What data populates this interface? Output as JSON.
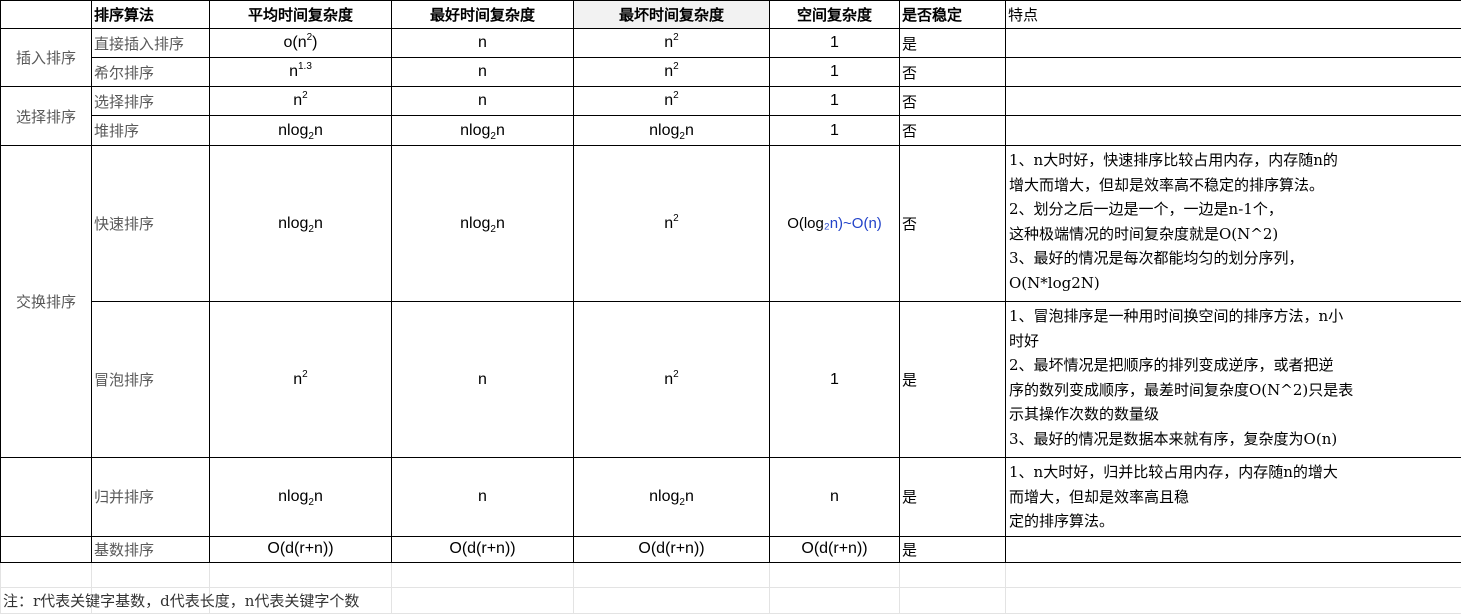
{
  "headers": {
    "algorithm": "排序算法",
    "avg": "平均时间复杂度",
    "best": "最好时间复杂度",
    "worst": "最坏时间复杂度",
    "space": "空间复杂度",
    "stable": "是否稳定",
    "features": "特点"
  },
  "categories": {
    "insertion": "插入排序",
    "selection": "选择排序",
    "exchange": "交换排序"
  },
  "rows": {
    "direct_insertion": {
      "name": "直接插入排序",
      "avg": "o(n",
      "avg_sup": "2",
      "avg_tail": ")",
      "best": "n",
      "worst": "n",
      "worst_sup": "2",
      "space": "1",
      "stable": "是"
    },
    "shell": {
      "name": "希尔排序",
      "avg": "n",
      "avg_sup": "1.3",
      "best": "n",
      "worst": "n",
      "worst_sup": "2",
      "space": "1",
      "stable": "否"
    },
    "selection": {
      "name": "选择排序",
      "avg": "n",
      "avg_sup": "2",
      "best": "n",
      "worst": "n",
      "worst_sup": "2",
      "space": "1",
      "stable": "否"
    },
    "heap": {
      "name": "堆排序",
      "log_pre": "nlog",
      "log_sub": "2",
      "log_post": "n",
      "space": "1",
      "stable": "否"
    },
    "quick": {
      "name": "快速排序",
      "log_pre": "nlog",
      "log_sub": "2",
      "log_post": "n",
      "worst": "n",
      "worst_sup": "2",
      "space_a": "O(log",
      "space_b": "₂",
      "space_c": "n)~O(n)",
      "stable": "否",
      "features": [
        "1、n大时好，快速排序比较占用内存，内存随n的",
        "增大而增大，但却是效率高不稳定的排序算法。",
        "2、划分之后一边是一个，一边是n-1个，",
        "这种极端情况的时间复杂度就是O(N^2)",
        "3、最好的情况是每次都能均匀的划分序列，",
        "O(N*log2N)"
      ]
    },
    "bubble": {
      "name": "冒泡排序",
      "avg": "n",
      "avg_sup": "2",
      "best": "n",
      "worst": "n",
      "worst_sup": "2",
      "space": "1",
      "stable": "是",
      "features": [
        "1、冒泡排序是一种用时间换空间的排序方法，n小",
        "时好",
        "2、最坏情况是把顺序的排列变成逆序，或者把逆",
        "序的数列变成顺序，最差时间复杂度O(N^2)只是表",
        "示其操作次数的数量级",
        "3、最好的情况是数据本来就有序，复杂度为O(n)"
      ]
    },
    "merge": {
      "name": "归并排序",
      "log_pre": "nlog",
      "log_sub": "2",
      "log_post": "n",
      "best": "n",
      "space": "n",
      "stable": "是",
      "features": [
        "1、n大时好，归并比较占用内存，内存随n的增大",
        "而增大，但却是效率高且稳",
        "定的排序算法。"
      ]
    },
    "radix": {
      "name": "基数排序",
      "value": "O(d(r+n))",
      "stable": "是"
    }
  },
  "note": "注：r代表关键字基数，d代表长度，n代表关键字个数",
  "colors": {
    "blue_text": "#2243c9",
    "gray_text": "#595959",
    "header_highlight": "#f2f2f2"
  }
}
